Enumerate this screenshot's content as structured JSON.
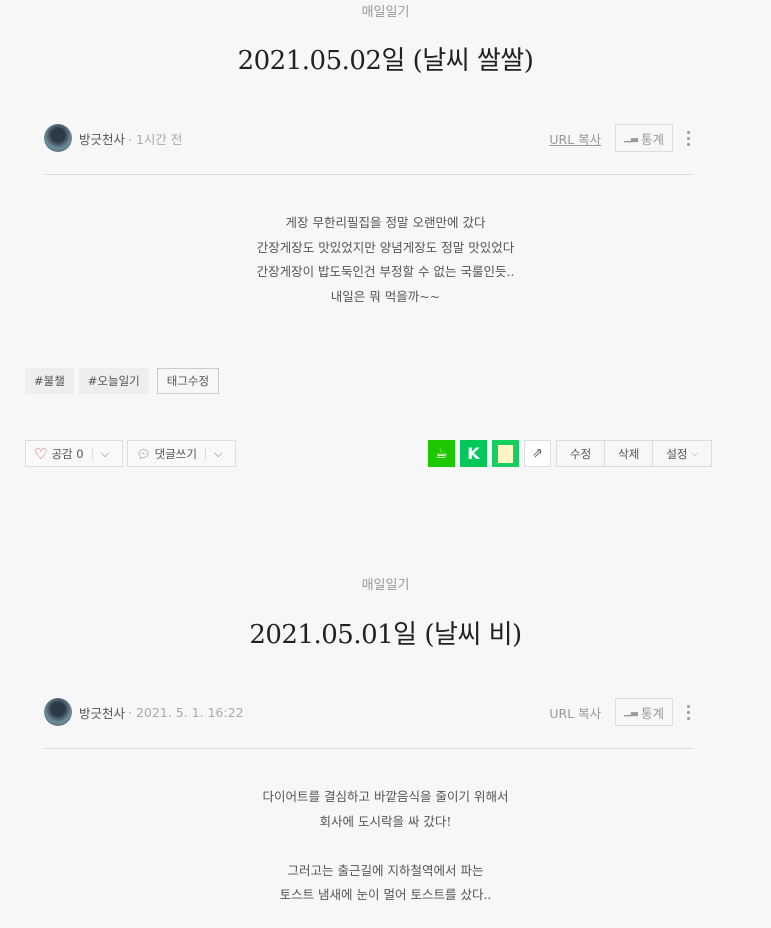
{
  "posts": [
    {
      "category": "매일일기",
      "title": "2021.05.02일 (날씨 쌀쌀)",
      "author": "방긋천사",
      "time": "· 1시간 전",
      "url_copy": "URL 복사",
      "stats": "통계",
      "body": [
        "게장 무한리필집을 정말 오랜만에 갔다",
        "간장게장도 맛있었지만 양념게장도 정말 맛있었다",
        "간장게장이 밥도둑인건 부정할 수 없는 국룰인듯..",
        "내일은 뭐 먹을까~~"
      ],
      "tags": [
        "#불챌",
        "#오늘일기"
      ],
      "tag_edit": "태그수정",
      "like": "공감 0",
      "comment": "댓글쓰기",
      "edit": "수정",
      "delete": "삭제",
      "settings": "설정"
    },
    {
      "category": "매일일기",
      "title": "2021.05.01일 (날씨 비)",
      "author": "방긋천사",
      "time": "· 2021. 5. 1. 16:22",
      "url_copy": "URL 복사",
      "stats": "통계",
      "body": [
        "다이어트를 결심하고 바깥음식을 줄이기 위해서",
        "회사에 도시락을 싸 갔다!",
        "",
        "그러고는 출근길에 지하철역에서 파는",
        "토스트 냄새에 눈이 멀어 토스트를 샀다.."
      ]
    }
  ]
}
